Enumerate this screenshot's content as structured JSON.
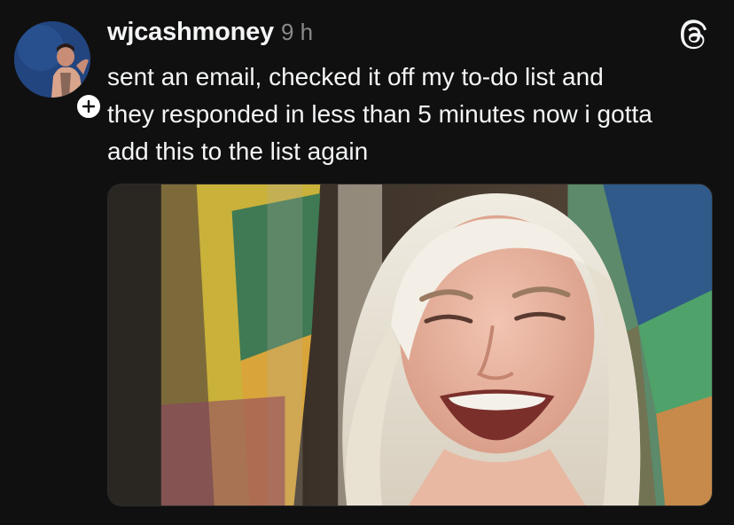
{
  "post": {
    "author": {
      "username": "wjcashmoney",
      "avatar_icon": "profile-photo",
      "follow_icon": "plus-icon"
    },
    "time_ago": "9 h",
    "text": "sent an email, checked it off my to-do list and\nthey responded in less than 5 minutes now i gotta\nadd this to the list again",
    "app_icon": "threads-logo-icon",
    "media": {
      "type": "image",
      "alt": "crying woman meme"
    }
  },
  "colors": {
    "background": "#101010",
    "text_primary": "#f3f5f7",
    "text_secondary": "#8a8a8a",
    "badge": "#ffffff"
  }
}
